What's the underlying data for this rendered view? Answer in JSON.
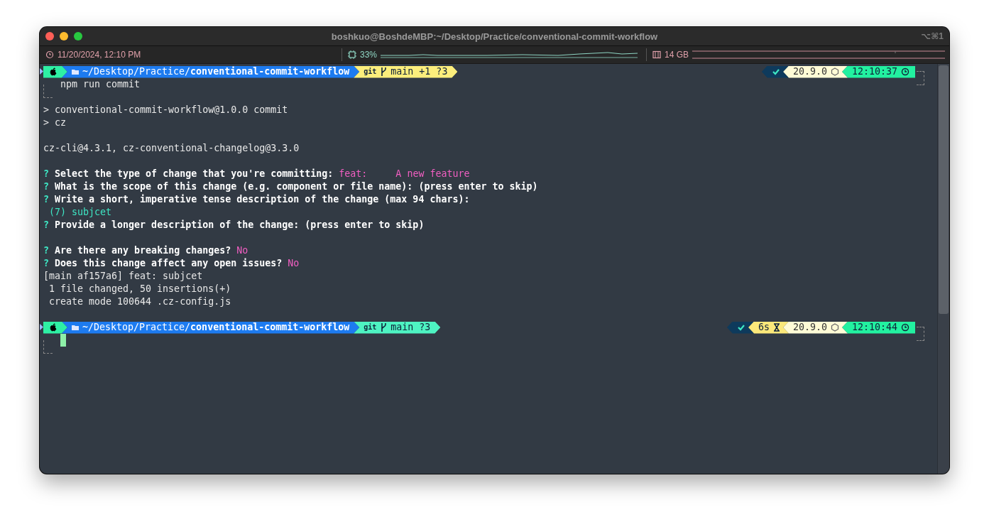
{
  "window": {
    "title": "boshkuo@BoshdeMBP:~/Desktop/Practice/conventional-commit-workflow",
    "shortcut": "⌥⌘1"
  },
  "status_bar": {
    "datetime": "11/20/2024, 12:10 PM",
    "cpu": "33%",
    "memory": "14 GB"
  },
  "lines": [
    {
      "kind": "prompt",
      "path_prefix": "~/Desktop/Practice/",
      "path_dir": "conventional-commit-workflow",
      "git_label": "git",
      "git_status": "main +1 ?3",
      "git_dirty": true,
      "status_ok": true,
      "node_version": "20.9.0",
      "time": "12:10:37",
      "cursor": false
    },
    {
      "kind": "command",
      "text": "npm run commit"
    },
    {
      "kind": "blank"
    },
    {
      "kind": "output",
      "segments": [
        {
          "text": "> conventional-commit-workflow@1.0.0 commit",
          "kind": "plain"
        }
      ]
    },
    {
      "kind": "output",
      "segments": [
        {
          "text": "> cz",
          "kind": "plain"
        }
      ]
    },
    {
      "kind": "blank"
    },
    {
      "kind": "output",
      "segments": [
        {
          "text": "cz-cli@4.3.1, cz-conventional-changelog@3.3.0",
          "kind": "plain"
        }
      ]
    },
    {
      "kind": "blank"
    },
    {
      "kind": "output",
      "segments": [
        {
          "text": "?",
          "kind": "mark"
        },
        {
          "text": "Select the type of change that you're committing:",
          "kind": "question"
        },
        {
          "text": "feat:     A new feature",
          "kind": "answer"
        }
      ]
    },
    {
      "kind": "output",
      "segments": [
        {
          "text": "?",
          "kind": "mark"
        },
        {
          "text": "What is the scope of this change (e.g. component or file name): (press enter to skip)",
          "kind": "question"
        }
      ]
    },
    {
      "kind": "output",
      "segments": [
        {
          "text": "?",
          "kind": "mark"
        },
        {
          "text": "Write a short, imperative tense description of the change (max 94 chars):",
          "kind": "question"
        }
      ]
    },
    {
      "kind": "output",
      "segments": [
        {
          "text": " (7) subjcet",
          "kind": "input"
        }
      ]
    },
    {
      "kind": "output",
      "segments": [
        {
          "text": "?",
          "kind": "mark"
        },
        {
          "text": "Provide a longer description of the change: (press enter to skip)",
          "kind": "question"
        }
      ]
    },
    {
      "kind": "blank"
    },
    {
      "kind": "output",
      "segments": [
        {
          "text": "?",
          "kind": "mark"
        },
        {
          "text": "Are there any breaking changes?",
          "kind": "question"
        },
        {
          "text": "No",
          "kind": "answer"
        }
      ]
    },
    {
      "kind": "output",
      "segments": [
        {
          "text": "?",
          "kind": "mark"
        },
        {
          "text": "Does this change affect any open issues?",
          "kind": "question"
        },
        {
          "text": "No",
          "kind": "answer"
        }
      ]
    },
    {
      "kind": "output",
      "segments": [
        {
          "text": "[main af157a6] feat: subjcet",
          "kind": "plain"
        }
      ]
    },
    {
      "kind": "output",
      "segments": [
        {
          "text": " 1 file changed, 50 insertions(+)",
          "kind": "plain"
        }
      ]
    },
    {
      "kind": "output",
      "segments": [
        {
          "text": " create mode 100644 .cz-config.js",
          "kind": "plain"
        }
      ]
    },
    {
      "kind": "blank"
    },
    {
      "kind": "prompt",
      "path_prefix": "~/Desktop/Practice/",
      "path_dir": "conventional-commit-workflow",
      "git_label": "git",
      "git_status": "main ?3",
      "git_dirty": false,
      "status_ok": true,
      "duration": "6s",
      "node_version": "20.9.0",
      "time": "12:10:44",
      "cursor": true
    }
  ]
}
